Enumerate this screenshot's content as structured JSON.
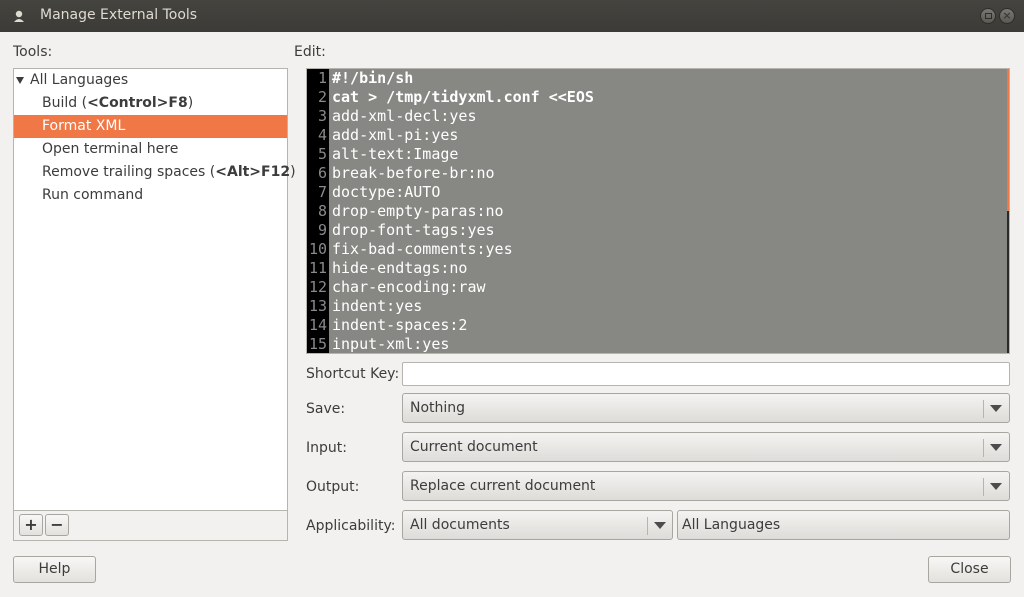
{
  "window": {
    "title": "Manage External Tools",
    "icon": "app-icon"
  },
  "tools_label": "Tools:",
  "edit_label": "Edit:",
  "tree": {
    "group": "All Languages",
    "items": [
      {
        "prefix": "Build (",
        "accel": "<Control>F8",
        "suffix": ")"
      },
      {
        "prefix": "Format XML",
        "accel": "",
        "suffix": ""
      },
      {
        "prefix": "Open terminal here",
        "accel": "",
        "suffix": ""
      },
      {
        "prefix": "Remove trailing spaces (",
        "accel": "<Alt>F12",
        "suffix": ")"
      },
      {
        "prefix": "Run command",
        "accel": "",
        "suffix": ""
      }
    ],
    "selected_index": 1
  },
  "toolbar": {
    "add": "+",
    "remove": "−"
  },
  "editor": {
    "lines": [
      {
        "num": "1",
        "text": "#!/bin/sh"
      },
      {
        "num": "2",
        "text": "cat > /tmp/tidyxml.conf <<EOS"
      },
      {
        "num": "3",
        "text": "add-xml-decl:yes"
      },
      {
        "num": "4",
        "text": "add-xml-pi:yes"
      },
      {
        "num": "5",
        "text": "alt-text:Image"
      },
      {
        "num": "6",
        "text": "break-before-br:no"
      },
      {
        "num": "7",
        "text": "doctype:AUTO"
      },
      {
        "num": "8",
        "text": "drop-empty-paras:no"
      },
      {
        "num": "9",
        "text": "drop-font-tags:yes"
      },
      {
        "num": "10",
        "text": "fix-bad-comments:yes"
      },
      {
        "num": "11",
        "text": "hide-endtags:no"
      },
      {
        "num": "12",
        "text": "char-encoding:raw"
      },
      {
        "num": "13",
        "text": "indent:yes"
      },
      {
        "num": "14",
        "text": "indent-spaces:2"
      },
      {
        "num": "15",
        "text": "input-xml:yes"
      }
    ]
  },
  "fields": {
    "shortcut_label": "Shortcut Key:",
    "shortcut_value": "",
    "save_label": "Save:",
    "save_value": "Nothing",
    "input_label": "Input:",
    "input_value": "Current document",
    "output_label": "Output:",
    "output_value": "Replace current document",
    "applicability_label": "Applicability:",
    "applicability_value": "All documents",
    "language_value": "All Languages"
  },
  "buttons": {
    "help": "Help",
    "close": "Close"
  },
  "colors": {
    "accent": "#f07746",
    "titlebar": "#3c3b37",
    "editor_bg": "#878884"
  }
}
